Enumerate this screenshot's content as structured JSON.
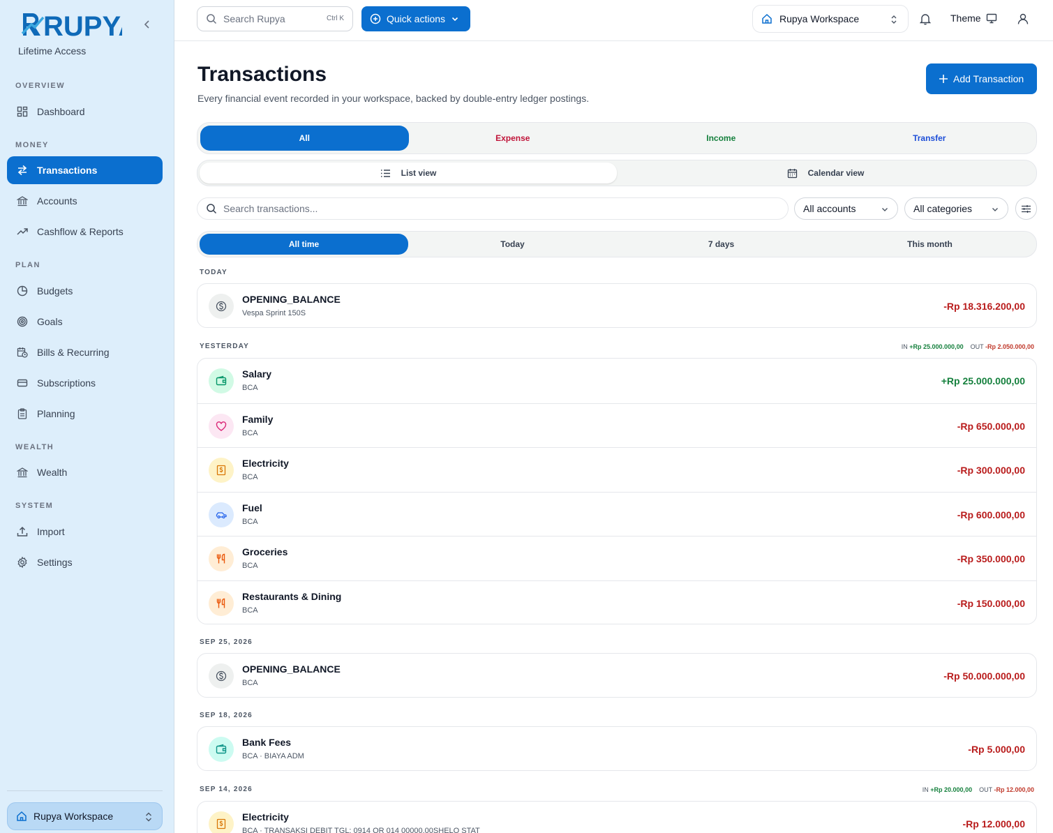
{
  "brand": {
    "name": "RUPYA",
    "subtitle": "Lifetime Access"
  },
  "sidebar": {
    "sections": [
      {
        "label": "OVERVIEW",
        "items": [
          {
            "label": "Dashboard",
            "icon": "dashboard-icon"
          }
        ]
      },
      {
        "label": "MONEY",
        "items": [
          {
            "label": "Transactions",
            "icon": "transfer-arrows-icon",
            "active": true
          },
          {
            "label": "Accounts",
            "icon": "bank-icon"
          },
          {
            "label": "Cashflow & Reports",
            "icon": "trend-up-icon"
          }
        ]
      },
      {
        "label": "PLAN",
        "items": [
          {
            "label": "Budgets",
            "icon": "pie-icon"
          },
          {
            "label": "Goals",
            "icon": "target-icon"
          },
          {
            "label": "Bills & Recurring",
            "icon": "calendar-clock-icon"
          },
          {
            "label": "Subscriptions",
            "icon": "card-icon"
          },
          {
            "label": "Planning",
            "icon": "clipboard-icon"
          }
        ]
      },
      {
        "label": "WEALTH",
        "items": [
          {
            "label": "Wealth",
            "icon": "bank-icon"
          }
        ]
      },
      {
        "label": "SYSTEM",
        "items": [
          {
            "label": "Import",
            "icon": "upload-icon"
          },
          {
            "label": "Settings",
            "icon": "gear-icon"
          }
        ]
      }
    ],
    "workspace": "Rupya Workspace"
  },
  "topbar": {
    "search_placeholder": "Search Rupya",
    "shortcut": "Ctrl K",
    "quick_actions": "Quick actions",
    "workspace": "Rupya Workspace",
    "theme": "Theme"
  },
  "page": {
    "title": "Transactions",
    "subtitle": "Every financial event recorded in your workspace, backed by double-entry ledger postings.",
    "add_button": "Add Transaction"
  },
  "type_filter": {
    "options": [
      "All",
      "Expense",
      "Income",
      "Transfer"
    ],
    "selected": "All"
  },
  "view_toggle": {
    "list": "List view",
    "calendar": "Calendar view",
    "selected": "List view"
  },
  "filters": {
    "search_placeholder": "Search transactions...",
    "accounts": "All accounts",
    "categories": "All categories"
  },
  "time_filter": {
    "options": [
      "All time",
      "Today",
      "7 days",
      "This month"
    ],
    "selected": "All time"
  },
  "groups": [
    {
      "label": "TODAY",
      "summary": null,
      "items": [
        {
          "name": "OPENING_BALANCE",
          "sub": "Vespa Sprint 150S",
          "amount": "-Rp 18.316.200,00",
          "sign": "neg",
          "icon": "dollar-circle-icon",
          "tone": "gray"
        }
      ]
    },
    {
      "label": "YESTERDAY",
      "summary": {
        "in_label": "IN",
        "in": "+Rp 25.000.000,00",
        "out_label": "OUT",
        "out": "-Rp 2.050.000,00"
      },
      "items": [
        {
          "name": "Salary",
          "sub": "BCA",
          "amount": "+Rp 25.000.000,00",
          "sign": "pos",
          "icon": "wallet-icon",
          "tone": "green"
        },
        {
          "name": "Family",
          "sub": "BCA",
          "amount": "-Rp 650.000,00",
          "sign": "neg",
          "icon": "heart-icon",
          "tone": "pink"
        },
        {
          "name": "Electricity",
          "sub": "BCA",
          "amount": "-Rp 300.000,00",
          "sign": "neg",
          "icon": "bill-icon",
          "tone": "amber"
        },
        {
          "name": "Fuel",
          "sub": "BCA",
          "amount": "-Rp 600.000,00",
          "sign": "neg",
          "icon": "car-icon",
          "tone": "blue"
        },
        {
          "name": "Groceries",
          "sub": "BCA",
          "amount": "-Rp 350.000,00",
          "sign": "neg",
          "icon": "utensils-icon",
          "tone": "orange"
        },
        {
          "name": "Restaurants & Dining",
          "sub": "BCA",
          "amount": "-Rp 150.000,00",
          "sign": "neg",
          "icon": "utensils-icon",
          "tone": "orange"
        }
      ]
    },
    {
      "label": "SEP 25, 2026",
      "summary": null,
      "items": [
        {
          "name": "OPENING_BALANCE",
          "sub": "BCA",
          "amount": "-Rp 50.000.000,00",
          "sign": "neg",
          "icon": "dollar-circle-icon",
          "tone": "gray"
        }
      ]
    },
    {
      "label": "SEP 18, 2026",
      "summary": null,
      "items": [
        {
          "name": "Bank Fees",
          "sub": "BCA · BIAYA ADM",
          "amount": "-Rp 5.000,00",
          "sign": "neg",
          "icon": "wallet-icon",
          "tone": "teal"
        }
      ]
    },
    {
      "label": "SEP 14, 2026",
      "summary": {
        "in_label": "IN",
        "in": "+Rp 20.000,00",
        "out_label": "OUT",
        "out": "-Rp 12.000,00"
      },
      "items": [
        {
          "name": "Electricity",
          "sub": "BCA · TRANSAKSI DEBIT TGL: 0914 QR 014 00000.00SHELO STAT",
          "amount": "-Rp 12.000,00",
          "sign": "neg",
          "icon": "bill-icon",
          "tone": "amber"
        }
      ]
    }
  ],
  "colors": {
    "accent": "#0b6fcf",
    "expense": "#c0392b",
    "income": "#15803d",
    "transfer": "#1d4ed8",
    "sidebar_bg": "#ddeefb"
  }
}
